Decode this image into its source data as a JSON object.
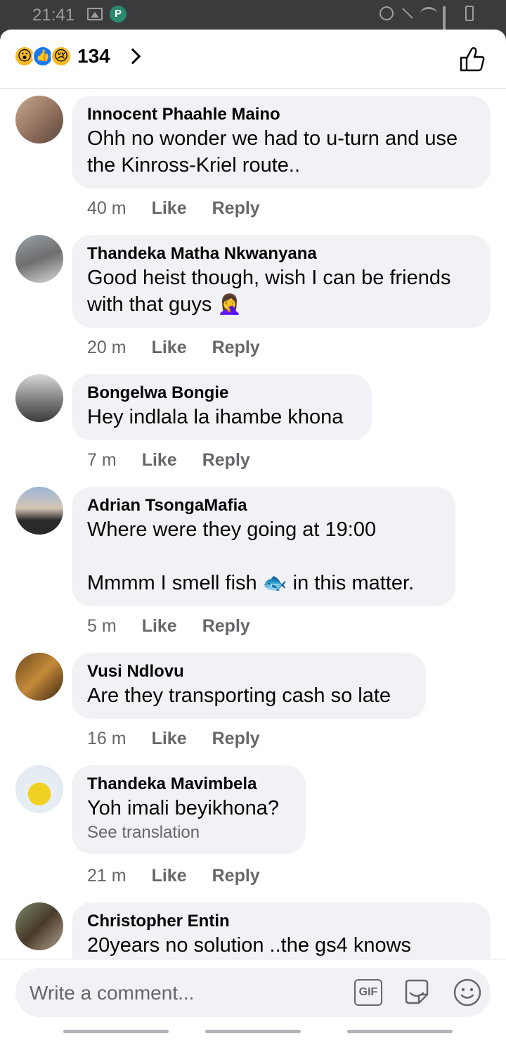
{
  "status_bar": {
    "time": "21:41",
    "app_badge": "P"
  },
  "header": {
    "reactions": [
      "wow",
      "like",
      "sad"
    ],
    "reaction_count": "134"
  },
  "comments": [
    {
      "name": "Innocent Phaahle Maino",
      "text": "Ohh no wonder we had to u-turn and use the Kinross-Kriel route..",
      "time": "40 m",
      "like": "Like",
      "reply": "Reply"
    },
    {
      "name": "Thandeka Matha Nkwanyana",
      "text": "Good heist though, wish I can be friends with that guys",
      "emoji": "🤦‍♀️",
      "time": "20 m",
      "like": "Like",
      "reply": "Reply"
    },
    {
      "name": "Bongelwa Bongie",
      "text": "Hey indlala la ihambe khona",
      "time": "7 m",
      "like": "Like",
      "reply": "Reply"
    },
    {
      "name": "Adrian TsongaMafia",
      "text_line1": "Where were they going at 19:00",
      "text_line2a": "Mmmm I smell fish",
      "emoji": "🐟",
      "text_line2b": "in this matter.",
      "time": "5 m",
      "like": "Like",
      "reply": "Reply"
    },
    {
      "name": "Vusi Ndlovu",
      "text": "Are they transporting cash so late",
      "time": "16 m",
      "like": "Like",
      "reply": "Reply"
    },
    {
      "name": "Thandeka Mavimbela",
      "text": "Yoh imali beyikhona?",
      "translate": "See translation",
      "time": "21 m",
      "like": "Like",
      "reply": "Reply"
    },
    {
      "name": "Christopher Entin",
      "text": "20years no solution  ..the gs4 knows"
    }
  ],
  "composer": {
    "placeholder": "Write a comment...",
    "gif_label": "GIF"
  },
  "colors": {
    "bubble": "#f0f2f5",
    "secondary_text": "#65676b",
    "like_blue": "#1877f2"
  }
}
